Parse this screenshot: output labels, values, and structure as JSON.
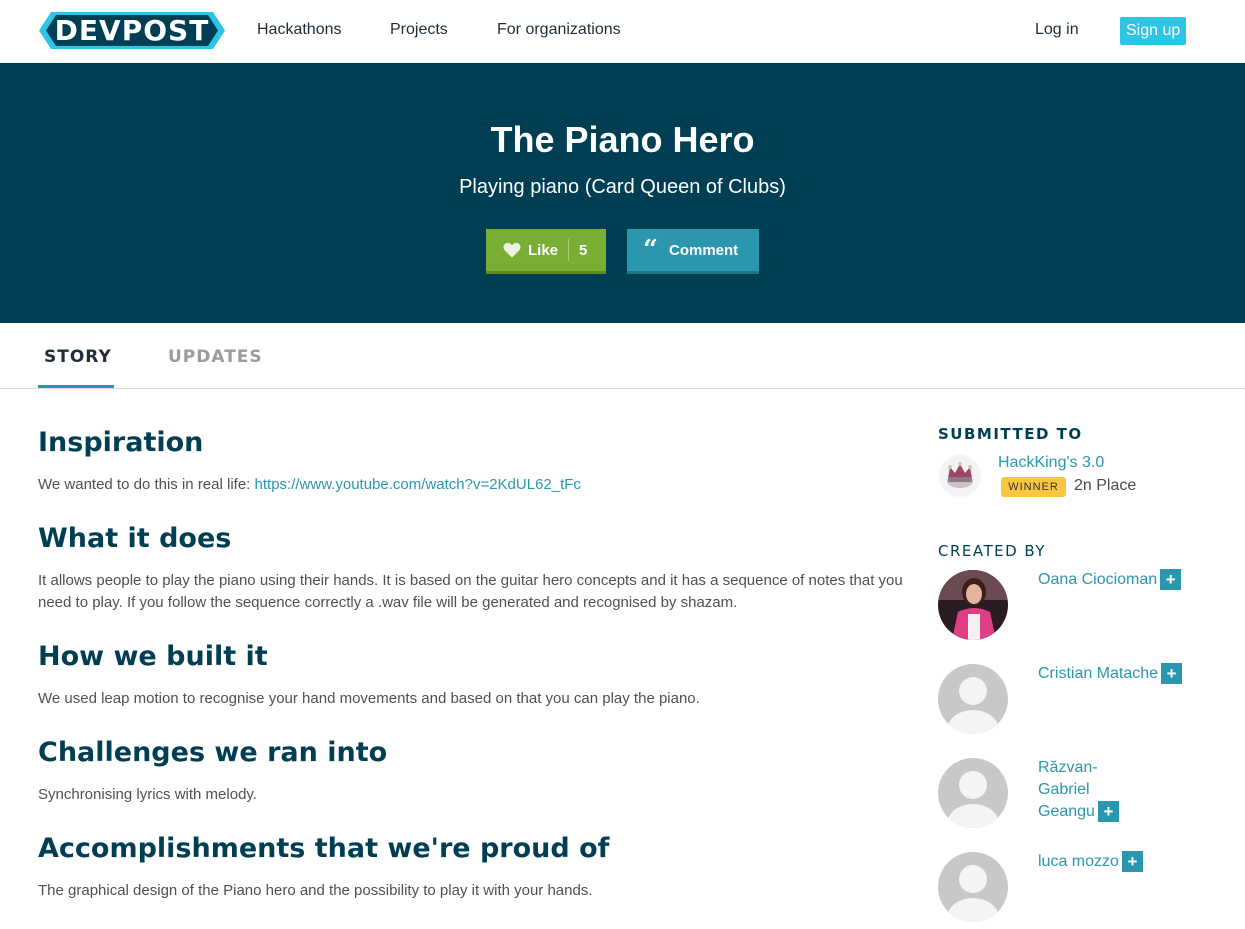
{
  "nav": {
    "logo": "DEVPOST",
    "links": [
      "Hackathons",
      "Projects",
      "For organizations"
    ],
    "login": "Log in",
    "signup": "Sign up"
  },
  "hero": {
    "title": "The Piano Hero",
    "tagline": "Playing piano (Card Queen of Clubs)",
    "like_label": "Like",
    "like_count": "5",
    "comment_label": "Comment"
  },
  "tabs": [
    "STORY",
    "UPDATES"
  ],
  "story": [
    {
      "heading": "Inspiration",
      "text": "We wanted to do this in real life: ",
      "link": "https://www.youtube.com/watch?v=2KdUL62_tFc"
    },
    {
      "heading": "What it does",
      "text": "It allows people to play the piano using their hands. It is based on the guitar hero concepts and it has a sequence of notes that you need to play. If you follow the sequence correctly a .wav file will be generated and recognised by shazam."
    },
    {
      "heading": "How we built it",
      "text": "We used leap motion to recognise your hand movements and based on that you can play the piano."
    },
    {
      "heading": "Challenges we ran into",
      "text": "Synchronising lyrics with melody."
    },
    {
      "heading": "Accomplishments that we're proud of",
      "text": "The graphical design of the Piano hero and the possibility to play it with your hands."
    }
  ],
  "sidebar": {
    "submitted_to": "SUBMITTED TO",
    "hackathon": "HackKing's 3.0",
    "winner_badge": "WINNER",
    "place": "2n Place",
    "created_by": "CREATED BY",
    "members": [
      "Oana Ciocioman",
      "Cristian Matache",
      "Răzvan-Gabriel Geangu",
      "luca mozzo"
    ],
    "plus": "+"
  },
  "colors": {
    "hero_bg": "#003e54",
    "accent": "#2b97ae",
    "like_green": "#7aad34",
    "signup_cyan": "#2ec4e6",
    "winner_yellow": "#f8c73e"
  }
}
